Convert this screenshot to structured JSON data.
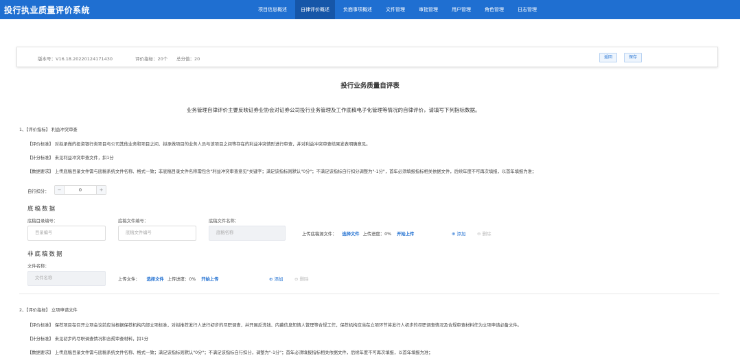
{
  "header": {
    "app_title": "投行执业质量评价系统",
    "nav": [
      {
        "label": "项目信息概述",
        "active": false
      },
      {
        "label": "自律评价概述",
        "active": true
      },
      {
        "label": "负面事项概述",
        "active": false
      },
      {
        "label": "文件管理",
        "active": false
      },
      {
        "label": "审批管理",
        "active": false
      },
      {
        "label": "用户管理",
        "active": false
      },
      {
        "label": "角色管理",
        "active": false
      },
      {
        "label": "日志管理",
        "active": false
      }
    ]
  },
  "version_bar": {
    "version": "版本号：V16.18.20220124171430",
    "indicator_count": "评价指标：20个",
    "total_score": "总分值：20",
    "back_label": "返回",
    "save_label": "保存"
  },
  "page": {
    "title": "投行业务质量自评表",
    "description": "业务管理自律评价主要反映证券业协会对证券公司投行业务管理及工作底稿电子化管理等情况的自律评价，请填写下列指标数据。"
  },
  "item1": {
    "heading": "1、【评价指标】 利益冲突审查",
    "criteria": "【评价标准】 对拟承做的投资银行类项目与公司其他业务和项目之间、拟承做项目的业务人员与该项目之间等存在的利益冲突情形进行审查，并对利益冲突审查结果发表明确意见。",
    "scoring": "【计分标准】 未见利益冲突审查文件，扣1分",
    "data_req": "【数据要求】 上传底稿目录文件需与底稿系统文件名称、格式一致；非底稿目录文件名称需包含\"利益冲突审查意见\"关键字；满足该指标则默认\"0分\"；不满足该指标自行扣分调整为\"-1分\"，首年必须填报指标相关依据文件，后续年度不可再次填报，以首年填报为准；",
    "self_score_label": "自行扣分：",
    "self_score_value": "0",
    "stepper_minus": "−",
    "stepper_plus": "+",
    "draft_section": {
      "title": "底稿数据",
      "catalog_no_label": "底稿目录编号：",
      "catalog_no_placeholder": "目录编号",
      "file_no_label": "底稿文件编号：",
      "file_no_placeholder": "底稿文件编号",
      "file_name_label": "底稿文件名称：",
      "file_name_placeholder": "底稿名称",
      "upload_label": "上传底稿源文件：",
      "choose_file": "选择文件",
      "progress": "上传进度：0%",
      "start_upload": "开始上传",
      "add": "⊕ 添加",
      "delete": "⊖ 删除"
    },
    "non_draft_section": {
      "title": "非底稿数据",
      "file_name_label": "文件名称：",
      "file_name_placeholder": "文件名称",
      "upload_label": "上传文件：",
      "choose_file": "选择文件",
      "progress": "上传进度：0%",
      "start_upload": "开始上传",
      "add": "⊕ 添加",
      "delete": "⊖ 删除"
    }
  },
  "item2": {
    "heading": "2、【评价指标】 立项申请文件",
    "criteria": "【评价标准】 保荐项目在召开立项会议前应当根据保荐机构内部立项标准，对拟推荐发行人进行初步的尽职调查，并开展反洗钱、内幕信息知情人管理等合规工作，保荐机构应当在立项环节将发行人初步的尽职调查情况及合规审查材料作为立项申请必备文件。",
    "scoring": "【计分标准】 未见初步的尽职调查情况和合规审查材料，扣1分",
    "data_req": "【数据要求】 上传底稿目录文件需与底稿系统文件名称、格式一致；满足该指标则默认\"0分\"；不满足该指标自行扣分，调整为\"-1分\"；首年必须填报指标相关依据文件，后续年度不可再次填报，以首年填报为准；"
  }
}
